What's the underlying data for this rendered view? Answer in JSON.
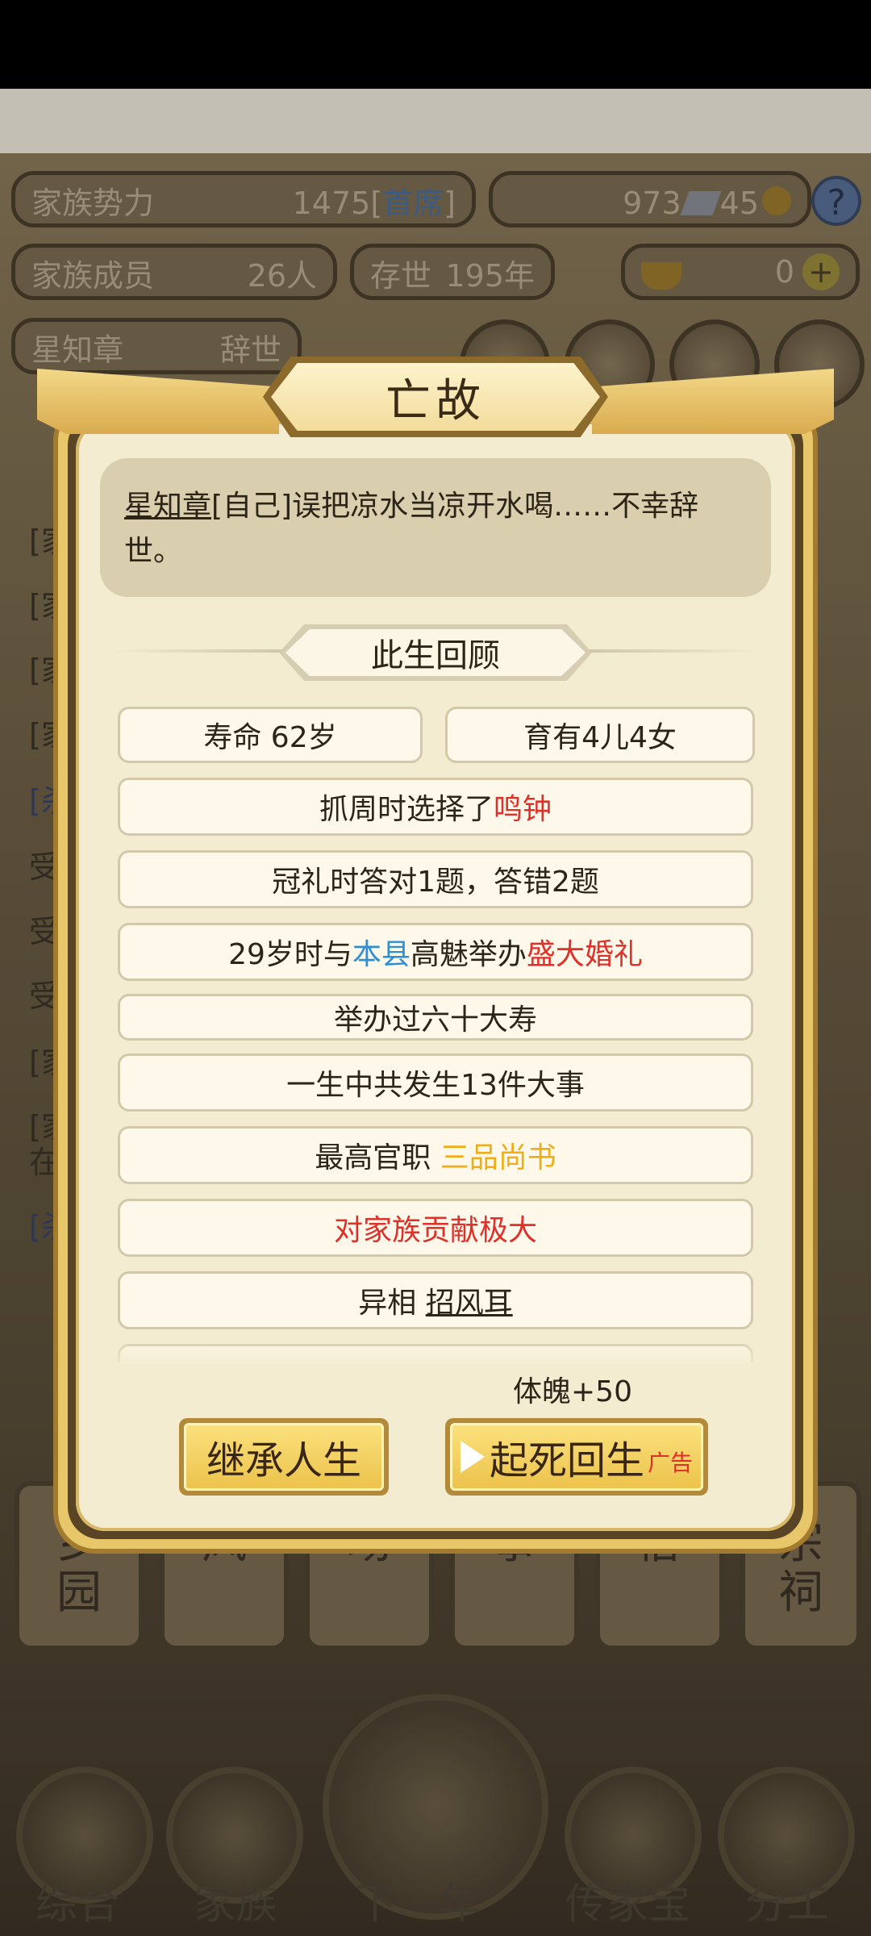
{
  "background": {
    "stats": {
      "clan_power_label": "家族势力",
      "clan_power_value": "1475[",
      "clan_power_rank": "首席",
      "clan_power_end": "]",
      "silver_value": "973",
      "gem_value": "45",
      "help": "?",
      "members_label": "家族成员",
      "members_value": "26人",
      "exist_label": "存世",
      "exist_value": "195年",
      "gold_value": "0",
      "plus": "+",
      "person_name": "星知章",
      "person_status": "辞世"
    },
    "side_lines": [
      "[家",
      "[家",
      "[家",
      "[家",
      "[杀",
      "受",
      "受",
      "受",
      "[家",
      "[家",
      "在",
      "[杀"
    ],
    "nav_tiles": [
      "乡\n园",
      "风",
      "场",
      "事",
      "俗",
      "宗\n祠"
    ],
    "bottom_nav": [
      "综合",
      "家族",
      "下一年",
      "传家宝",
      "分工"
    ]
  },
  "modal": {
    "title": "亡故",
    "message_name": "星知章",
    "message_rest": "[自己]误把凉水当凉开水喝……不幸辞世。",
    "review_title": "此生回顾",
    "rows": {
      "lifespan": "寿命 62岁",
      "children": "育有4儿4女",
      "zhuazhou_prefix": "抓周时选择了",
      "zhuazhou_item": "鸣钟",
      "guanli": "冠礼时答对1题，答错2题",
      "marriage_prefix": "29岁时与",
      "marriage_place": "本县",
      "marriage_mid": "高魅举办",
      "marriage_type": "盛大婚礼",
      "birthday": "举办过六十大寿",
      "events": "一生中共发生13件大事",
      "office_prefix": "最高官职 ",
      "office_value": "三品尚书",
      "contribution": "对家族贡献极大",
      "trait_prefix": "异相 ",
      "trait_value": "招风耳"
    },
    "bonus": "体魄+50",
    "inherit_button": "继承人生",
    "revive_button": "起死回生",
    "ad_tag": "广告"
  }
}
